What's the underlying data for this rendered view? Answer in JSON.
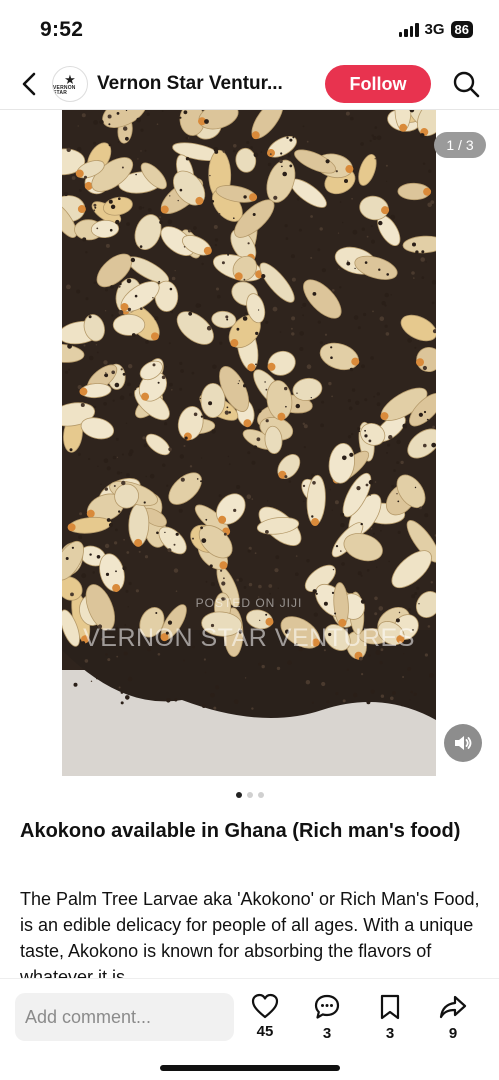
{
  "status": {
    "time": "9:52",
    "network": "3G",
    "battery": "86"
  },
  "header": {
    "account_name": "Vernon Star Ventur...",
    "avatar_text": "VERNON STAR",
    "follow_label": "Follow"
  },
  "media": {
    "page_counter": "1 / 3",
    "watermark_main": "VERNON STAR VENTURES",
    "watermark_sub": "POSTED ON JIJI",
    "slides": 3,
    "active_slide": 0
  },
  "post": {
    "title": "Akokono available in Ghana (Rich man's food)",
    "description": "The Palm Tree Larvae aka 'Akokono' or Rich Man's Food, is an edible delicacy for people of all ages. With a unique taste, Akokono is known for absorbing the flavors of whatever it is"
  },
  "bottom_bar": {
    "comment_placeholder": "Add comment...",
    "likes": "45",
    "comments": "3",
    "saves": "3",
    "shares": "9"
  },
  "colors": {
    "follow": "#e8334f",
    "counter_bg": "#9a9a9a"
  }
}
